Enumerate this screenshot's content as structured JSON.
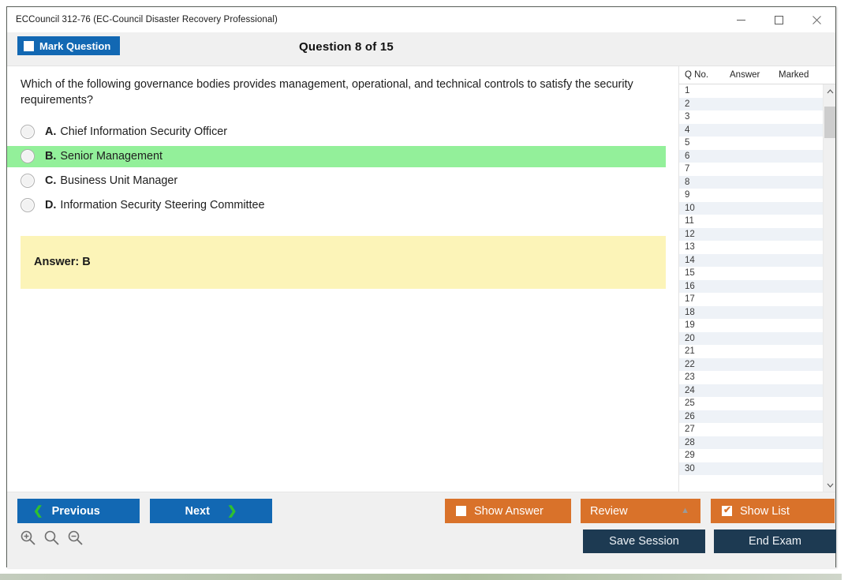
{
  "window": {
    "title": "ECCouncil 312-76 (EC-Council Disaster Recovery Professional)",
    "minimize_label": "Minimize",
    "maximize_label": "Maximize",
    "close_label": "Close"
  },
  "header": {
    "mark_question_label": "Mark Question",
    "question_counter": "Question 8 of 15"
  },
  "question": {
    "text": "Which of the following governance bodies provides management, operational, and technical controls to satisfy the security requirements?",
    "options": [
      {
        "letter": "A.",
        "text": "Chief Information Security Officer",
        "highlighted": false
      },
      {
        "letter": "B.",
        "text": "Senior Management",
        "highlighted": true
      },
      {
        "letter": "C.",
        "text": "Business Unit Manager",
        "highlighted": false
      },
      {
        "letter": "D.",
        "text": "Information Security Steering Committee",
        "highlighted": false
      }
    ],
    "answer_label": "Answer: B"
  },
  "question_list": {
    "columns": [
      "Q No.",
      "Answer",
      "Marked"
    ],
    "rows": [
      {
        "no": "1",
        "answer": "",
        "marked": ""
      },
      {
        "no": "2",
        "answer": "",
        "marked": ""
      },
      {
        "no": "3",
        "answer": "",
        "marked": ""
      },
      {
        "no": "4",
        "answer": "",
        "marked": ""
      },
      {
        "no": "5",
        "answer": "",
        "marked": ""
      },
      {
        "no": "6",
        "answer": "",
        "marked": ""
      },
      {
        "no": "7",
        "answer": "",
        "marked": ""
      },
      {
        "no": "8",
        "answer": "",
        "marked": ""
      },
      {
        "no": "9",
        "answer": "",
        "marked": ""
      },
      {
        "no": "10",
        "answer": "",
        "marked": ""
      },
      {
        "no": "11",
        "answer": "",
        "marked": ""
      },
      {
        "no": "12",
        "answer": "",
        "marked": ""
      },
      {
        "no": "13",
        "answer": "",
        "marked": ""
      },
      {
        "no": "14",
        "answer": "",
        "marked": ""
      },
      {
        "no": "15",
        "answer": "",
        "marked": ""
      },
      {
        "no": "16",
        "answer": "",
        "marked": ""
      },
      {
        "no": "17",
        "answer": "",
        "marked": ""
      },
      {
        "no": "18",
        "answer": "",
        "marked": ""
      },
      {
        "no": "19",
        "answer": "",
        "marked": ""
      },
      {
        "no": "20",
        "answer": "",
        "marked": ""
      },
      {
        "no": "21",
        "answer": "",
        "marked": ""
      },
      {
        "no": "22",
        "answer": "",
        "marked": ""
      },
      {
        "no": "23",
        "answer": "",
        "marked": ""
      },
      {
        "no": "24",
        "answer": "",
        "marked": ""
      },
      {
        "no": "25",
        "answer": "",
        "marked": ""
      },
      {
        "no": "26",
        "answer": "",
        "marked": ""
      },
      {
        "no": "27",
        "answer": "",
        "marked": ""
      },
      {
        "no": "28",
        "answer": "",
        "marked": ""
      },
      {
        "no": "29",
        "answer": "",
        "marked": ""
      },
      {
        "no": "30",
        "answer": "",
        "marked": ""
      }
    ]
  },
  "toolbar": {
    "previous_label": "Previous",
    "next_label": "Next",
    "show_answer_label": "Show Answer",
    "show_answer_checked": false,
    "review_label": "Review",
    "show_list_label": "Show List",
    "show_list_checked": true,
    "save_session_label": "Save Session",
    "end_exam_label": "End Exam",
    "zoom_in_label": "Zoom In",
    "zoom_reset_label": "Zoom Reset",
    "zoom_out_label": "Zoom Out"
  },
  "colors": {
    "accent_blue": "#1268b3",
    "accent_orange": "#d9722a",
    "dark_navy": "#1d3a52",
    "highlight_green": "#93f09a",
    "answer_yellow": "#fcf4b8",
    "chevron_green": "#2fc02f"
  }
}
